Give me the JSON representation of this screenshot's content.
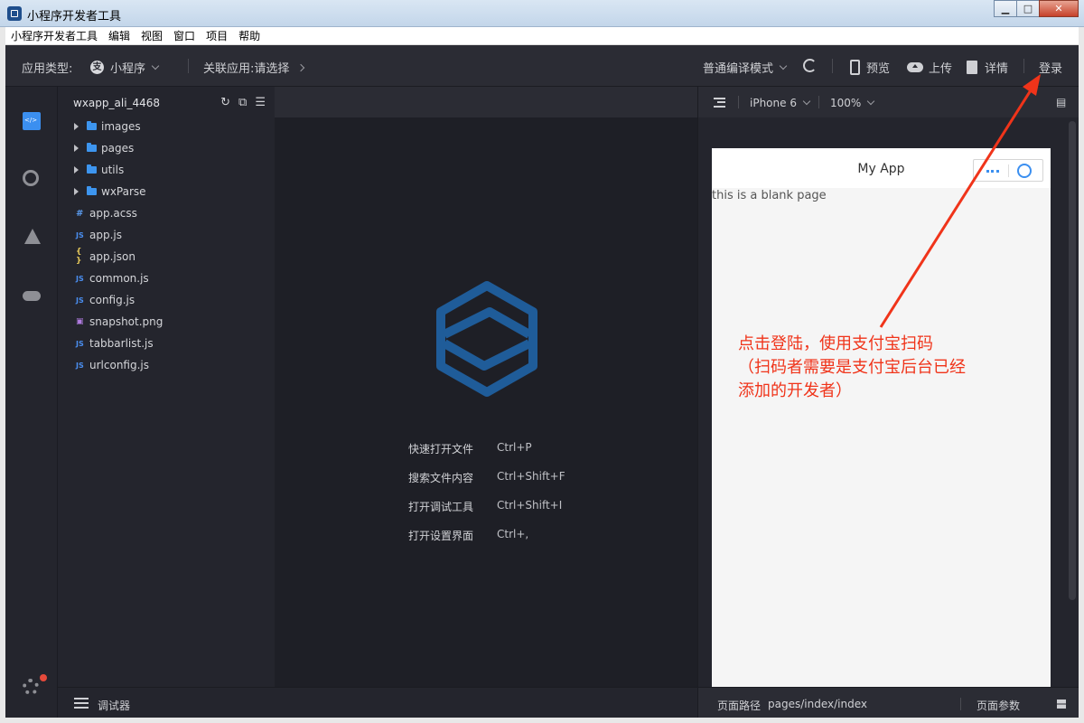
{
  "window": {
    "title": "小程序开发者工具",
    "controls": {
      "minimize": "▁",
      "maximize": "□",
      "close": "✕"
    }
  },
  "menubar": {
    "items": [
      "小程序开发者工具",
      "编辑",
      "视图",
      "窗口",
      "项目",
      "帮助"
    ]
  },
  "toolbar": {
    "app_type_label": "应用类型:",
    "app_type_value": "小程序",
    "linked_app_label": "关联应用:",
    "linked_app_value": "请选择",
    "compile_mode": "普通编译模式",
    "preview": "预览",
    "upload": "上传",
    "details": "详情",
    "login": "登录"
  },
  "activity_icons": [
    "code-file-icon",
    "search-icon",
    "flask-icon",
    "cloud-icon",
    "gear-icon"
  ],
  "explorer": {
    "project_name": "wxapp_ali_4468",
    "folders": [
      "images",
      "pages",
      "utils",
      "wxParse"
    ],
    "files": [
      {
        "name": "app.acss",
        "type": "css",
        "glyph": "#"
      },
      {
        "name": "app.js",
        "type": "js",
        "glyph": "JS"
      },
      {
        "name": "app.json",
        "type": "json",
        "glyph": "{ }"
      },
      {
        "name": "common.js",
        "type": "js",
        "glyph": "JS"
      },
      {
        "name": "config.js",
        "type": "js",
        "glyph": "JS"
      },
      {
        "name": "snapshot.png",
        "type": "png",
        "glyph": "▣"
      },
      {
        "name": "tabbarlist.js",
        "type": "js",
        "glyph": "JS"
      },
      {
        "name": "urlconfig.js",
        "type": "js",
        "glyph": "JS"
      }
    ]
  },
  "editor": {
    "shortcuts": [
      {
        "label": "快速打开文件",
        "key": "Ctrl+P"
      },
      {
        "label": "搜索文件内容",
        "key": "Ctrl+Shift+F"
      },
      {
        "label": "打开调试工具",
        "key": "Ctrl+Shift+I"
      },
      {
        "label": "打开设置界面",
        "key": "Ctrl+,"
      }
    ]
  },
  "simulator": {
    "device": "iPhone 6",
    "zoom": "100%",
    "nav_title": "My App",
    "body_text": "this is a blank page"
  },
  "statusbar": {
    "debugger": "调试器",
    "page_path_label": "页面路径",
    "page_path_value": "pages/index/index",
    "page_params": "页面参数"
  },
  "annotation": {
    "line1": "点击登陆，使用支付宝扫码",
    "line2": "（扫码者需要是支付宝后台已经",
    "line3": "添加的开发者）",
    "color": "#f0341a"
  },
  "colors": {
    "accent": "#3b8ff0",
    "logo": "#1f5c99",
    "background": "#24252d"
  }
}
